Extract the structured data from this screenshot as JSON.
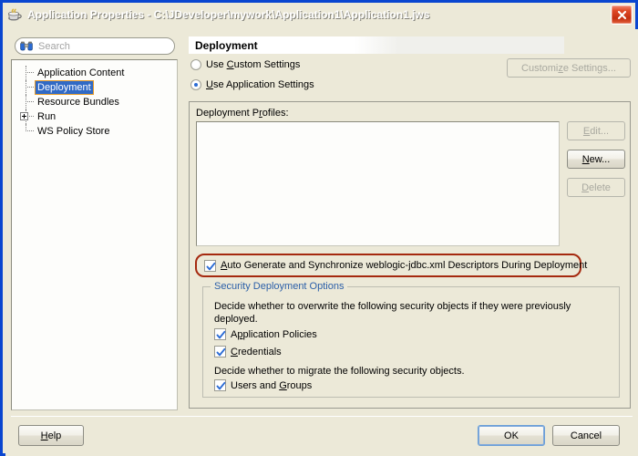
{
  "window": {
    "title": "Application Properties - C:\\JDeveloper\\mywork\\Application1\\Application1.jws",
    "app_icon": "java-coffee-cup-icon",
    "close_label": "Close"
  },
  "sidebar": {
    "search": {
      "placeholder": "Search",
      "value": "",
      "icon": "binoculars-icon"
    },
    "items": [
      {
        "label": "Application Content",
        "selected": false,
        "expandable": false
      },
      {
        "label": "Deployment",
        "selected": true,
        "expandable": false
      },
      {
        "label": "Resource Bundles",
        "selected": false,
        "expandable": false
      },
      {
        "label": "Run",
        "selected": false,
        "expandable": true
      },
      {
        "label": "WS Policy Store",
        "selected": false,
        "expandable": false
      }
    ]
  },
  "main": {
    "header": "Deployment",
    "settings_mode": {
      "custom": {
        "label_pre": "Use ",
        "mnemonic": "C",
        "label_post": "ustom Settings",
        "selected": false
      },
      "application": {
        "label_pre": "",
        "mnemonic": "U",
        "label_post": "se Application Settings",
        "selected": true
      }
    },
    "customize_button": {
      "label": "Customi",
      "mnemonic": "z",
      "label_post": "e Settings...",
      "enabled": false
    },
    "profiles": {
      "label_pre": "Deployment P",
      "mnemonic": "r",
      "label_post": "ofiles:",
      "items": []
    },
    "profile_buttons": [
      {
        "label_pre": "",
        "mnemonic": "E",
        "label_post": "dit...",
        "enabled": false,
        "name": "edit-profile-button"
      },
      {
        "label_pre": "",
        "mnemonic": "N",
        "label_post": "ew...",
        "enabled": true,
        "name": "new-profile-button"
      },
      {
        "label_pre": "",
        "mnemonic": "D",
        "label_post": "elete",
        "enabled": false,
        "name": "delete-profile-button"
      }
    ],
    "auto_generate": {
      "label_pre": "",
      "mnemonic": "A",
      "label_post": "uto Generate and Synchronize weblogic-jdbc.xml Descriptors During Deployment",
      "checked": true,
      "highlight_color": "#a5290f"
    },
    "security_group": {
      "title": "Security Deployment Options",
      "title_color": "#2b5fa8",
      "overwrite_text": "Decide whether to overwrite the following security objects if they were previously deployed.",
      "overwrite_options": [
        {
          "label_pre": "A",
          "mnemonic": "p",
          "label_post": "plication Policies",
          "checked": true
        },
        {
          "label_pre": "",
          "mnemonic": "C",
          "label_post": "redentials",
          "checked": true
        }
      ],
      "migrate_text": "Decide whether to migrate the following security objects.",
      "migrate_options": [
        {
          "label_pre": "Users and ",
          "mnemonic": "G",
          "label_post": "roups",
          "checked": true
        }
      ]
    }
  },
  "footer": {
    "help": {
      "label_pre": "",
      "mnemonic": "H",
      "label_post": "elp"
    },
    "ok": {
      "label": "OK",
      "default": true
    },
    "cancel": {
      "label": "Cancel"
    }
  },
  "colors": {
    "titlebar_blue": "#0f56d2",
    "dialog_face": "#ece9d8",
    "selection_blue": "#316ac5",
    "focus_orange": "#e59b2a",
    "annotation_red": "#a5290f",
    "group_title_blue": "#2b5fa8"
  }
}
